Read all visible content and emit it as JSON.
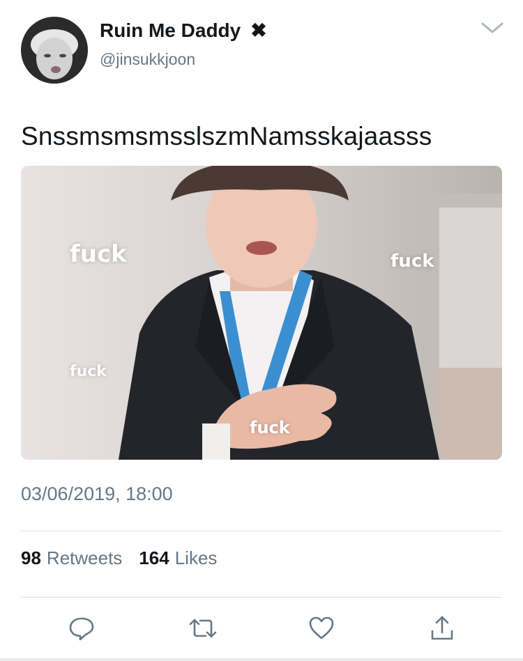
{
  "tweet": {
    "author": {
      "display_name": "Ruin Me Daddy",
      "handle": "@jinsukkjoon",
      "badge_icon": "x-mark-icon"
    },
    "text": "SnssmsmsmsslszmNamsskajaasss",
    "media": {
      "overlay_words": [
        "fuck",
        "fuck",
        "fuck",
        "fuck"
      ]
    },
    "timestamp": "03/06/2019, 18:00",
    "stats": {
      "retweets_count": "98",
      "retweets_label": "Retweets",
      "likes_count": "164",
      "likes_label": "Likes"
    },
    "actions": [
      {
        "icon": "reply-icon"
      },
      {
        "icon": "retweet-icon"
      },
      {
        "icon": "like-icon"
      },
      {
        "icon": "share-icon"
      }
    ]
  },
  "colors": {
    "text_primary": "#14171a",
    "text_secondary": "#657786",
    "divider": "#d9dee2",
    "icon": "#657786"
  }
}
